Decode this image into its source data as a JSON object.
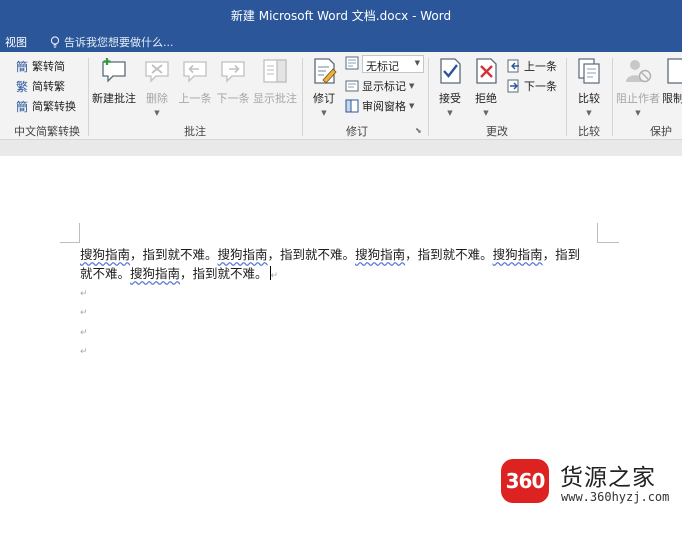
{
  "window": {
    "title": "新建 Microsoft Word 文档.docx - Word"
  },
  "tabs": {
    "view": "视图"
  },
  "tell_me": {
    "placeholder": "告诉我您想要做什么..."
  },
  "ribbon": {
    "chinese_conversion": {
      "label": "中文简繁转换",
      "to_simplified": "繁转简",
      "to_traditional": "简转繁",
      "convert": "简繁转换"
    },
    "comments": {
      "label": "批注",
      "new": "新建批注",
      "delete": "删除",
      "previous": "上一条",
      "next": "下一条",
      "show": "显示批注"
    },
    "tracking": {
      "label": "修订",
      "track_changes": "修订",
      "markup_mode": "无标记",
      "show_markup": "显示标记",
      "reviewing_pane": "审阅窗格"
    },
    "changes": {
      "label": "更改",
      "accept": "接受",
      "reject": "拒绝",
      "previous": "上一条",
      "next": "下一条"
    },
    "compare": {
      "label": "比较",
      "compare": "比较"
    },
    "protect": {
      "label": "保护",
      "block_authors": "阻止作者",
      "restrict": "限制"
    }
  },
  "document": {
    "line1": {
      "p1a": "搜狗指南",
      "p1b": "，指到就不难。",
      "p2a": "搜狗指南",
      "p2b": "，指到就不难。",
      "p3a": "搜狗指南",
      "p3b": "，指到就不难。",
      "p4a": "搜狗指南",
      "p4b": "，指到"
    },
    "line2": {
      "p1": "就不难。",
      "p2a": "搜狗指南",
      "p2b": "，指到就不难。"
    },
    "paragraph_mark": "↵"
  },
  "watermark": {
    "badge": "360",
    "title": "货源之家",
    "url": "www.360hyzj.com"
  },
  "colors": {
    "title_bar": "#2b579a",
    "ribbon": "#f3f3f3",
    "spell_underline": "#5b7bd5",
    "watermark_red": "#dd2222"
  }
}
